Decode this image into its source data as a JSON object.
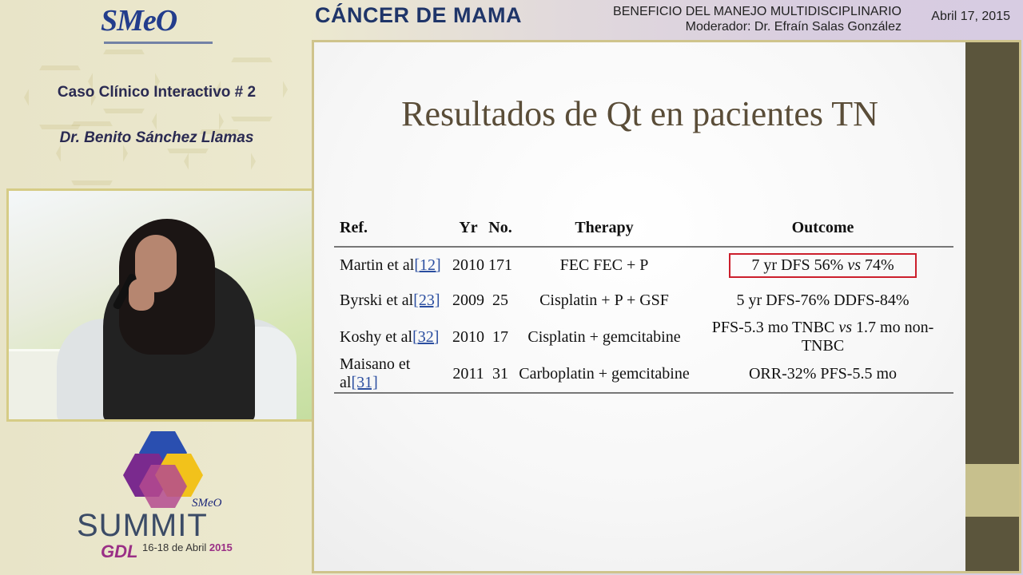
{
  "header": {
    "logo_text": "SMeO",
    "conference_title": "CÁNCER DE MAMA",
    "session_title": "BENEFICIO DEL MANEJO MULTIDISCIPLINARIO",
    "moderator": "Moderador: Dr. Efraín Salas González",
    "date": "Abril 17, 2015"
  },
  "left_panel": {
    "case_title": "Caso Clínico Interactivo # 2",
    "presenter": "Dr. Benito Sánchez Llamas"
  },
  "summit_logo": {
    "word": "SUMMIT",
    "smeo": "SMeO",
    "gdl": "GDL",
    "dates": "16-18 de Abril",
    "year": "2015"
  },
  "slide": {
    "title": "Resultados de Qt en pacientes TN",
    "table": {
      "headers": [
        "Ref.",
        "Yr",
        "No.",
        "Therapy",
        "Outcome"
      ],
      "rows": [
        {
          "author": "Martin et al",
          "ref": "[12]",
          "yr": "2010",
          "no": "171",
          "therapy": "FEC FEC + P",
          "outcome": "7 yr DFS 56% vs 74%",
          "highlighted": true
        },
        {
          "author": "Byrski et al",
          "ref": "[23]",
          "yr": "2009",
          "no": "25",
          "therapy": "Cisplatin + P + GSF",
          "outcome": "5 yr DFS-76% DDFS-84%",
          "highlighted": false
        },
        {
          "author": "Koshy et al",
          "ref": "[32]",
          "yr": "2010",
          "no": "17",
          "therapy": "Cisplatin + gemcitabine",
          "outcome": "PFS-5.3 mo TNBC vs 1.7 mo non-TNBC",
          "highlighted": false
        },
        {
          "author": "Maisano et al",
          "ref": "[31]",
          "yr": "2011",
          "no": "31",
          "therapy": "Carboplatin + gemcitabine",
          "outcome": "ORR-32% PFS-5.5 mo",
          "highlighted": false
        }
      ]
    }
  },
  "colors": {
    "highlight_border": "#cc1f2c",
    "slide_sidebar": "#5b553c",
    "header_title": "#1f3569"
  }
}
